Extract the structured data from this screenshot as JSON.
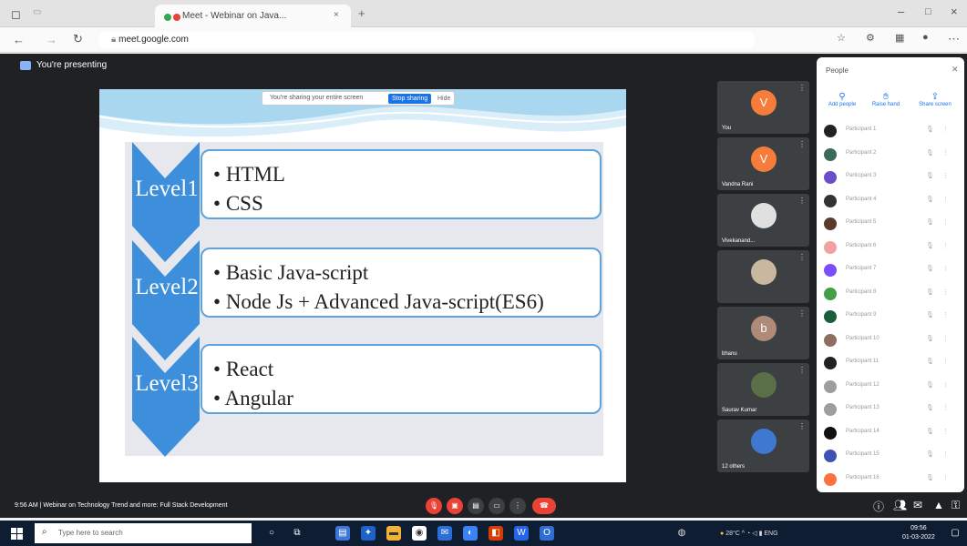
{
  "browser": {
    "tab_title": "Meet - Webinar on Java...",
    "url_domain": "meet.google.com",
    "tab_close": "×",
    "new_tab": "+",
    "minimize": "–",
    "maximize": "□",
    "close": "×"
  },
  "meet": {
    "presenting_banner": "You're presenting",
    "share_notice": "You're sharing your entire screen",
    "stop_sharing": "Stop sharing",
    "hide": "Hide",
    "meeting_info": "Webinar on Technology Trend and more: Full Stack Development",
    "time": "9:56 AM"
  },
  "slide": {
    "levels": [
      {
        "label": "Level1",
        "bullets": [
          "HTML",
          "CSS"
        ]
      },
      {
        "label": "Level2",
        "bullets": [
          "Basic Java-script",
          "Node Js + Advanced Java-script(ES6)"
        ]
      },
      {
        "label": "Level3",
        "bullets": [
          "React",
          "Angular"
        ]
      }
    ]
  },
  "tiles": [
    {
      "initial": "V",
      "name": "You",
      "color": "#f57c3a"
    },
    {
      "initial": "V",
      "name": "Vandna Rani",
      "color": "#f57c3a"
    },
    {
      "initial": "",
      "name": "Vivekanand...",
      "color": "#e0e0e0"
    },
    {
      "initial": "",
      "name": "",
      "color": "#c8b8a0"
    },
    {
      "initial": "b",
      "name": "bhanu",
      "color": "#b08a78"
    },
    {
      "initial": "",
      "name": "Saurav Kumar",
      "color": "#5a6e48"
    },
    {
      "initial": "",
      "name": "12 others",
      "color": "#3f78d0"
    }
  ],
  "people_panel": {
    "title": "People",
    "actions": [
      "Add people",
      "Raise hand",
      "Share screen"
    ],
    "participants": [
      {
        "name": "Participant 1",
        "color": "#222222"
      },
      {
        "name": "Participant 2",
        "color": "#3a6b5a"
      },
      {
        "name": "Participant 3",
        "color": "#6a4fc9"
      },
      {
        "name": "Participant 4",
        "color": "#333333"
      },
      {
        "name": "Participant 5",
        "color": "#5a3a2a"
      },
      {
        "name": "Participant 6",
        "color": "#f2a0a0"
      },
      {
        "name": "Participant 7",
        "color": "#7c4dff"
      },
      {
        "name": "Participant 8",
        "color": "#43a047"
      },
      {
        "name": "Participant 9",
        "color": "#1b5e3a"
      },
      {
        "name": "Participant 10",
        "color": "#8d6e63"
      },
      {
        "name": "Participant 11",
        "color": "#222222"
      },
      {
        "name": "Participant 12",
        "color": "#9e9e9e"
      },
      {
        "name": "Participant 13",
        "color": "#9e9e9e"
      },
      {
        "name": "Participant 14",
        "color": "#111111"
      },
      {
        "name": "Participant 15",
        "color": "#3f51b5"
      },
      {
        "name": "Participant 16",
        "color": "#ff7043"
      }
    ]
  },
  "taskbar": {
    "search_placeholder": "Type here to search",
    "weather": "28°C",
    "clock_time": "09:56",
    "clock_date": "01-03-2022",
    "language": "ENG"
  }
}
